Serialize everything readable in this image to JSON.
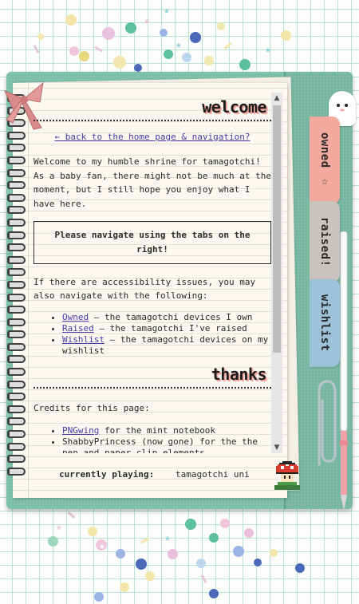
{
  "sections": {
    "welcome_heading": "welcome",
    "thanks_heading": "thanks"
  },
  "back_link": "← back to the home page & navigation?",
  "welcome_text": "Welcome to my humble shrine for tamagotchi! As a baby fan, there might not be much at the moment, but I still hope you enjoy what I have here.",
  "notice": "Please navigate using the tabs on the right!",
  "accessibility_text": "If there are accessibility issues, you may also navigate with the following:",
  "nav_list": [
    {
      "link": "Owned",
      "desc": " — the tamagotchi devices I own"
    },
    {
      "link": "Raised",
      "desc": " — the tamagotchi I've raised"
    },
    {
      "link": "Wishlist",
      "desc": " — the tamagotchi devices on my wishlist"
    }
  ],
  "credits_intro": "Credits for this page:",
  "credits": [
    {
      "link": "PNGwing",
      "desc": " for the mint notebook"
    },
    {
      "link": "",
      "desc": "ShabbyPrincess (now gone) for the the pen and paper clip elements"
    }
  ],
  "tabs": {
    "owned": "owned ☆",
    "raised": "raised!",
    "wishlist": "wishlist"
  },
  "player": {
    "label": "currently playing:",
    "song": "tamagotchi uni"
  },
  "scroll": {
    "up": "▲",
    "down": "▼"
  },
  "colors": {
    "cover": "#7cbfa8",
    "tab_owned": "#f3a99d",
    "tab_raised": "#c8c3be",
    "tab_wishlist": "#9cc3da",
    "heading_shadow": "#f2a89e",
    "link": "#4a3aa8"
  }
}
